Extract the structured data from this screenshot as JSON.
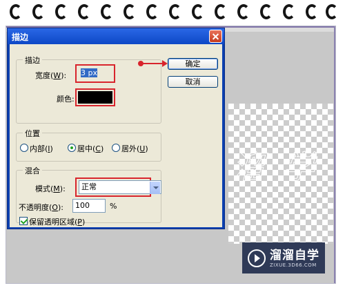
{
  "dialog": {
    "title": "描边",
    "stroke_group": {
      "legend": "描边",
      "width_label_prefix": "宽度(",
      "width_label_key": "W",
      "width_label_suffix": "):",
      "width_value": "3 px",
      "color_label": "颜色:",
      "color_value": "#000000"
    },
    "position_group": {
      "legend": "位置",
      "options": [
        {
          "prefix": "内部(",
          "key": "I",
          "suffix": ")",
          "checked": false
        },
        {
          "prefix": "居中(",
          "key": "C",
          "suffix": ")",
          "checked": true
        },
        {
          "prefix": "居外(",
          "key": "U",
          "suffix": ")",
          "checked": false
        }
      ]
    },
    "blend_group": {
      "legend": "混合",
      "mode_label_prefix": "模式(",
      "mode_label_key": "M",
      "mode_label_suffix": "):",
      "mode_value": "正常",
      "opacity_label_prefix": "不透明度(",
      "opacity_label_key": "O",
      "opacity_label_suffix": "):",
      "opacity_value": "100",
      "opacity_unit": "%",
      "preserve_prefix": "保留透明区域(",
      "preserve_key": "P",
      "preserve_suffix": ")",
      "preserve_checked": true
    },
    "ok_label": "确定",
    "cancel_label": "取消"
  },
  "watermark": {
    "title": "溜溜自学",
    "subtitle": "ZIXUE.3D66.COM"
  },
  "colors": {
    "annotation_red": "#d8242c",
    "title_bar_blue": "#0d48c6",
    "dialog_bg": "#ece9d8"
  }
}
